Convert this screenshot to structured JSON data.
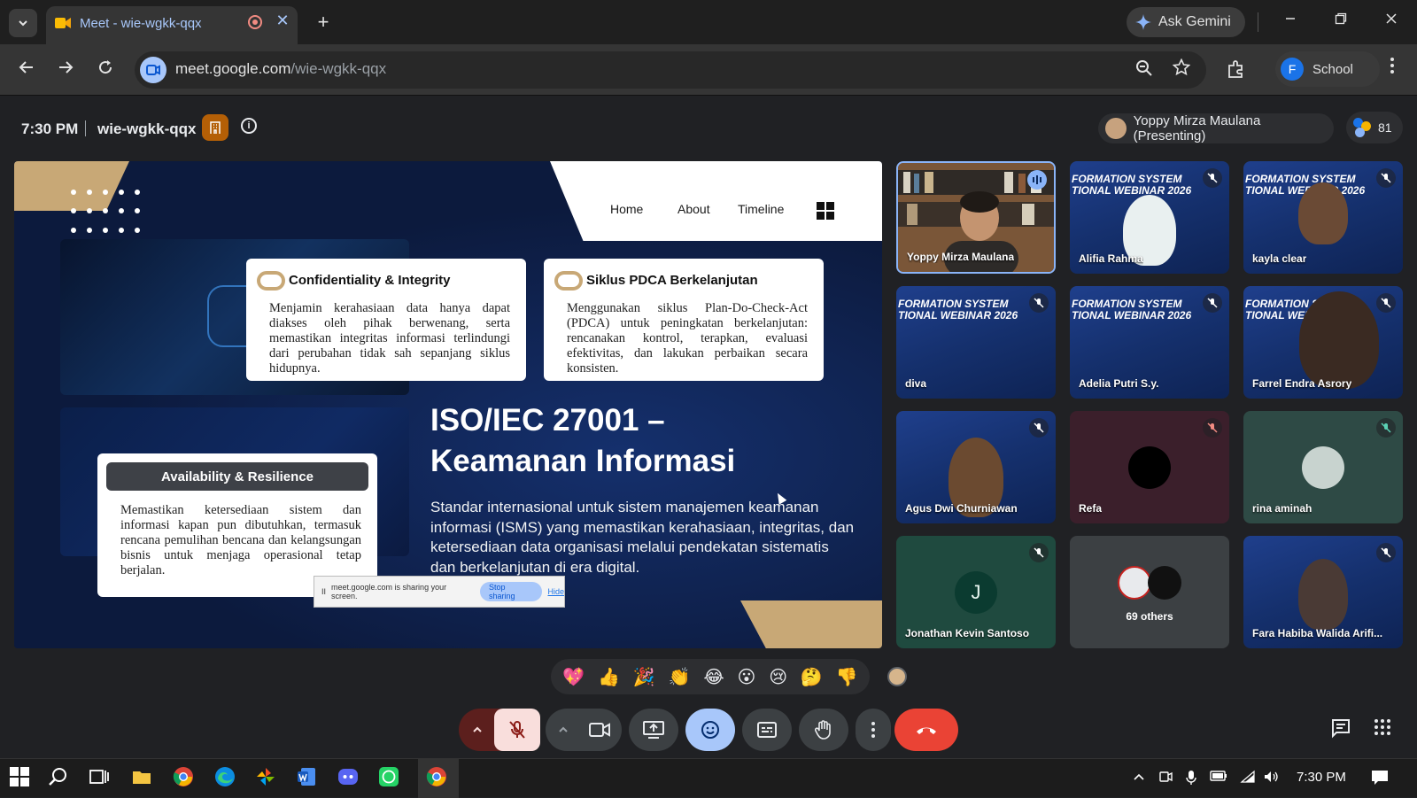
{
  "browser": {
    "tab_title": "Meet - wie-wgkk-qqx",
    "gemini_label": "Ask Gemini",
    "url_host": "meet.google.com",
    "url_path": "/wie-wgkk-qqx",
    "profile_initial": "F",
    "profile_name": "School",
    "new_tab_glyph": "+",
    "close_glyph": "✕"
  },
  "meet": {
    "time": "7:30 PM",
    "meeting_code": "wie-wgkk-qqx",
    "presenter_chip": "Yoppy Mirza Maulana (Presenting)",
    "participant_count": "81"
  },
  "slide": {
    "nav": [
      "Home",
      "About",
      "Timeline"
    ],
    "cards": [
      {
        "title": "Confidentiality & Integrity",
        "body": "Menjamin kerahasiaan data hanya dapat diakses oleh pihak berwenang, serta memastikan integritas informasi terlindungi dari perubahan tidak sah sepanjang siklus hidupnya."
      },
      {
        "title": "Siklus PDCA Berkelanjutan",
        "body": "Menggunakan siklus Plan-Do-Check-Act (PDCA) untuk peningkatan berkelanjutan: rencanakan kontrol, terapkan, evaluasi efektivitas, dan lakukan perbaikan secara konsisten."
      },
      {
        "title": "Availability & Resilience",
        "body": "Memastikan ketersediaan sistem dan informasi kapan pun dibutuhkan, termasuk rencana pemulihan bencana dan kelangsungan bisnis untuk menjaga operasional tetap berjalan."
      }
    ],
    "title_line1": "ISO/IEC 27001 –",
    "title_line2": "Keamanan Informasi",
    "description": "Standar internasional untuk sistem manajemen keamanan informasi (ISMS) yang memastikan kerahasiaan, integritas, dan ketersediaan data organisasi melalui pendekatan sistematis dan berkelanjutan di era digital.",
    "share_banner": {
      "text": "meet.google.com is sharing your screen.",
      "stop": "Stop sharing",
      "hide": "Hide"
    }
  },
  "participants": [
    {
      "name": "Yoppy Mirza Maulana",
      "type": "video-speaking"
    },
    {
      "name": "Alifia Rahma",
      "type": "webinar-person"
    },
    {
      "name": "kayla clear",
      "type": "webinar-person"
    },
    {
      "name": "diva",
      "type": "webinar"
    },
    {
      "name": "Adelia Putri S.y.",
      "type": "webinar"
    },
    {
      "name": "Farrel Endra Asrory",
      "type": "webinar-person"
    },
    {
      "name": "Agus Dwi Churniawan",
      "type": "webinar-person"
    },
    {
      "name": "Refa",
      "type": "avatar"
    },
    {
      "name": "rina aminah",
      "type": "avatar"
    },
    {
      "name": "Jonathan Kevin Santoso",
      "type": "initial",
      "initial": "J"
    },
    {
      "name": "69 others",
      "type": "others"
    },
    {
      "name": "Fara Habiba Walida Arifi...",
      "type": "webinar-person"
    }
  ],
  "webinar_banner_text": "FORMATION SYSTEM\nTIONAL WEBINAR 2026",
  "reactions": [
    "💖",
    "👍",
    "🎉",
    "👏",
    "😂",
    "😮",
    "😢",
    "🤔",
    "👎"
  ],
  "taskbar": {
    "time": "7:30 PM"
  },
  "colors": {
    "accent_blue": "#a8c7fa",
    "end_call_red": "#ea4335",
    "mic_muted_bg": "#f9dedc",
    "slide_gold": "#c8a876",
    "slide_navy": "#0c1a3d"
  }
}
